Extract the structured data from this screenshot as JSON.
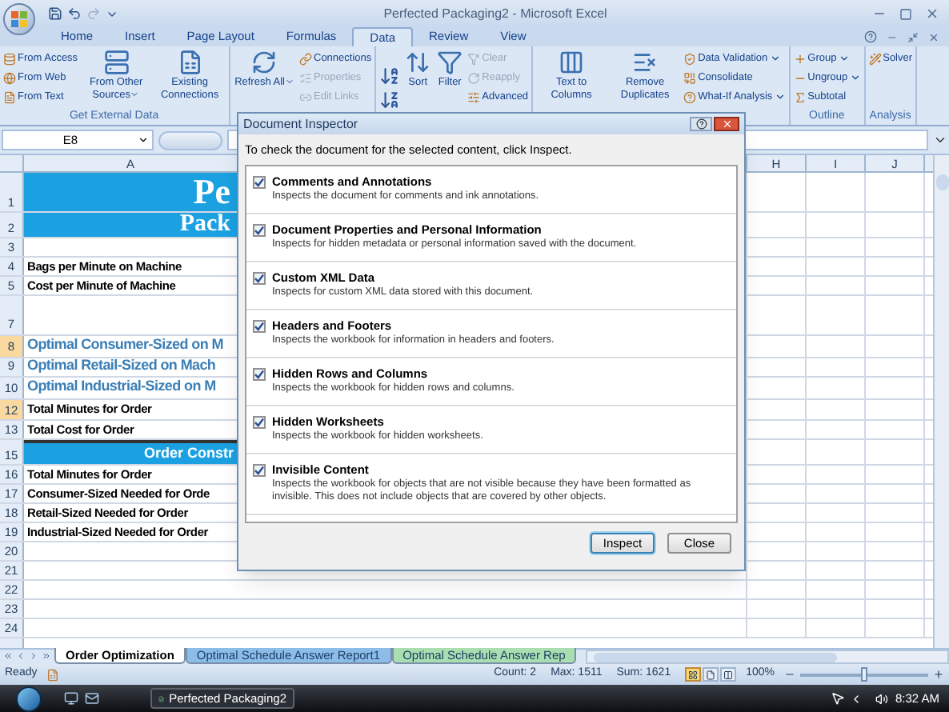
{
  "window": {
    "title": "Perfected Packaging2 - Microsoft Excel"
  },
  "ribbon_tabs": [
    {
      "label": "Home",
      "selected": false
    },
    {
      "label": "Insert",
      "selected": false
    },
    {
      "label": "Page Layout",
      "selected": false
    },
    {
      "label": "Formulas",
      "selected": false
    },
    {
      "label": "Data",
      "selected": true
    },
    {
      "label": "Review",
      "selected": false
    },
    {
      "label": "View",
      "selected": false
    }
  ],
  "ribbon_groups": [
    {
      "label": "Get External Data",
      "columns": [
        {
          "kind": "stack",
          "items": [
            {
              "label": "From Access",
              "disabled": false,
              "dropdown": false
            },
            {
              "label": "From Web",
              "disabled": false,
              "dropdown": false
            },
            {
              "label": "From Text",
              "disabled": false,
              "dropdown": false
            }
          ]
        },
        {
          "kind": "large",
          "label": "From Other Sources",
          "dropdown": true
        },
        {
          "kind": "large",
          "label": "Existing Connections",
          "dropdown": false
        }
      ]
    },
    {
      "columns": [
        {
          "kind": "large",
          "label": "Refresh All",
          "dropdown": true
        },
        {
          "kind": "stack",
          "items": [
            {
              "label": "Connections",
              "disabled": false,
              "dropdown": false
            },
            {
              "label": "Properties",
              "disabled": true,
              "dropdown": false
            },
            {
              "label": "Edit Links",
              "disabled": true,
              "dropdown": false
            }
          ]
        }
      ]
    },
    {
      "columns": [
        {
          "kind": "sort-buttons"
        },
        {
          "kind": "large",
          "label": "Sort",
          "dropdown": false
        },
        {
          "kind": "large",
          "label": "Filter",
          "dropdown": false
        },
        {
          "kind": "stack",
          "items": [
            {
              "label": "Clear",
              "disabled": true,
              "dropdown": false
            },
            {
              "label": "Reapply",
              "disabled": true,
              "dropdown": false
            },
            {
              "label": "Advanced",
              "disabled": false,
              "dropdown": false
            }
          ]
        }
      ]
    },
    {
      "columns": [
        {
          "kind": "large",
          "label": "Text to Columns",
          "dropdown": false
        },
        {
          "kind": "large",
          "label": "Remove Duplicates",
          "dropdown": false
        },
        {
          "kind": "stack",
          "items": [
            {
              "label": "Data Validation",
              "disabled": false,
              "dropdown": true
            },
            {
              "label": "Consolidate",
              "disabled": false,
              "dropdown": false
            },
            {
              "label": "What-If Analysis",
              "disabled": false,
              "dropdown": true
            }
          ]
        }
      ]
    },
    {
      "label": "Outline",
      "columns": [
        {
          "kind": "stack",
          "items": [
            {
              "label": "Group",
              "disabled": false,
              "dropdown": true
            },
            {
              "label": "Ungroup",
              "disabled": false,
              "dropdown": true
            },
            {
              "label": "Subtotal",
              "disabled": false,
              "dropdown": false
            }
          ]
        }
      ]
    },
    {
      "label": "Analysis",
      "columns": [
        {
          "kind": "stack",
          "items": [
            {
              "label": "Solver",
              "disabled": false,
              "dropdown": false
            }
          ]
        }
      ]
    }
  ],
  "formula_bar": {
    "name_box": "E8"
  },
  "columns": [
    "A",
    "H",
    "I",
    "J"
  ],
  "rows": [
    {
      "number": "1",
      "selected": false,
      "kind": "banner-title",
      "text": "Pe"
    },
    {
      "number": "2",
      "selected": false,
      "kind": "banner-subtitle",
      "text": "Pack"
    },
    {
      "number": "3",
      "selected": false,
      "kind": "blank"
    },
    {
      "number": "4",
      "selected": false,
      "kind": "label",
      "text": "Bags per Minute on Machine"
    },
    {
      "number": "5",
      "selected": false,
      "kind": "label",
      "text": "Cost per Minute of Machine"
    },
    {
      "number": "7",
      "selected": false,
      "kind": "blank"
    },
    {
      "number": "8",
      "selected": true,
      "kind": "heading",
      "text": "Optimal Consumer-Sized on M"
    },
    {
      "number": "9",
      "selected": false,
      "kind": "heading",
      "text": "Optimal Retail-Sized on Mach"
    },
    {
      "number": "10",
      "selected": false,
      "kind": "heading",
      "text": "Optimal Industrial-Sized on M"
    },
    {
      "number": "12",
      "selected": true,
      "kind": "label",
      "text": "Total Minutes for Order"
    },
    {
      "number": "13",
      "selected": false,
      "kind": "label",
      "text": "Total Cost for Order"
    },
    {
      "number": "15",
      "selected": false,
      "kind": "band",
      "text": "Order Constr"
    },
    {
      "number": "16",
      "selected": false,
      "kind": "label",
      "text": "Total Minutes for Order"
    },
    {
      "number": "17",
      "selected": false,
      "kind": "label",
      "text": "Consumer-Sized Needed for Orde"
    },
    {
      "number": "18",
      "selected": false,
      "kind": "label",
      "text": "Retail-Sized Needed for Order"
    },
    {
      "number": "19",
      "selected": false,
      "kind": "label",
      "text": "Industrial-Sized Needed for Order"
    },
    {
      "number": "20",
      "selected": false,
      "kind": "blank"
    },
    {
      "number": "21",
      "selected": false,
      "kind": "blank"
    },
    {
      "number": "22",
      "selected": false,
      "kind": "blank"
    },
    {
      "number": "23",
      "selected": false,
      "kind": "blank"
    },
    {
      "number": "24",
      "selected": false,
      "kind": "blank"
    }
  ],
  "dialog": {
    "title": "Document Inspector",
    "instruction": "To check the document for the selected content, click Inspect.",
    "items": [
      {
        "title": "Comments and Annotations",
        "description": "Inspects the document for comments and ink annotations.",
        "checked": true
      },
      {
        "title": "Document Properties and Personal Information",
        "description": "Inspects for hidden metadata or personal information saved with the document.",
        "checked": true
      },
      {
        "title": "Custom XML Data",
        "description": "Inspects for custom XML data stored with this document.",
        "checked": true
      },
      {
        "title": "Headers and Footers",
        "description": "Inspects the workbook for information in headers and footers.",
        "checked": true
      },
      {
        "title": "Hidden Rows and Columns",
        "description": "Inspects the workbook for hidden rows and columns.",
        "checked": true
      },
      {
        "title": "Hidden Worksheets",
        "description": "Inspects the workbook for hidden worksheets.",
        "checked": true
      },
      {
        "title": "Invisible Content",
        "description": "Inspects the workbook for objects that are not visible because they have been formatted as invisible. This does not include objects that are covered by other objects.",
        "checked": true
      }
    ],
    "buttons": [
      {
        "label": "Inspect",
        "default": true
      },
      {
        "label": "Close",
        "default": false
      }
    ]
  },
  "sheet_tabs": [
    {
      "label": "Order Optimization",
      "selected": true,
      "color": "#ffffff"
    },
    {
      "label": "Optimal Schedule Answer Report1",
      "selected": false,
      "color": "#8cbce8"
    },
    {
      "label": "Optimal Schedule Answer Rep",
      "selected": false,
      "color": "#a9dfb0"
    }
  ],
  "status_bar": {
    "mode": "Ready",
    "stats": [
      "Count: 2",
      "Max: 1511",
      "Sum: 1621"
    ],
    "views": [
      {
        "selected": true
      },
      {
        "selected": false
      },
      {
        "selected": false
      }
    ],
    "zoom": "100%",
    "zoom_slider": {
      "level": 0.5
    }
  },
  "taskbar": {
    "tasks": [
      {
        "label": "Perfected Packaging2",
        "selected": false
      }
    ],
    "clock": "8:32 AM"
  }
}
